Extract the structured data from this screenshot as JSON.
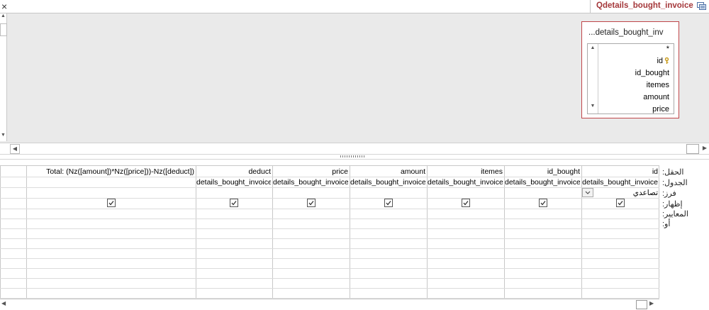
{
  "tab": {
    "close_glyph": "×",
    "title": "Qdetails_bought_invoice"
  },
  "field_list": {
    "title": "...details_bought_inv",
    "items": [
      "*",
      "id",
      "id_bought",
      "itemes",
      "amount",
      "price"
    ]
  },
  "grid": {
    "row_labels": [
      "الحقل:",
      "الجدول:",
      "فرز:",
      "إظهار:",
      "المعايير:",
      "أو:"
    ],
    "columns": [
      {
        "field": "id",
        "table": "details_bought_invoice",
        "sort": "تصاعدي",
        "show": true
      },
      {
        "field": "id_bought",
        "table": "details_bought_invoice",
        "sort": "",
        "show": true
      },
      {
        "field": "itemes",
        "table": "details_bought_invoice",
        "sort": "",
        "show": true
      },
      {
        "field": "amount",
        "table": "details_bought_invoice",
        "sort": "",
        "show": true
      },
      {
        "field": "price",
        "table": "details_bought_invoice",
        "sort": "",
        "show": true
      },
      {
        "field": "deduct",
        "table": "details_bought_invoice",
        "sort": "",
        "show": true
      },
      {
        "field": "Total: (Nz([amount])*Nz([price]))-Nz([deduct])",
        "table": "",
        "sort": "",
        "show": true
      }
    ]
  },
  "colors": {
    "accent": "#a4373a",
    "pane_bg": "#eaeaea"
  }
}
